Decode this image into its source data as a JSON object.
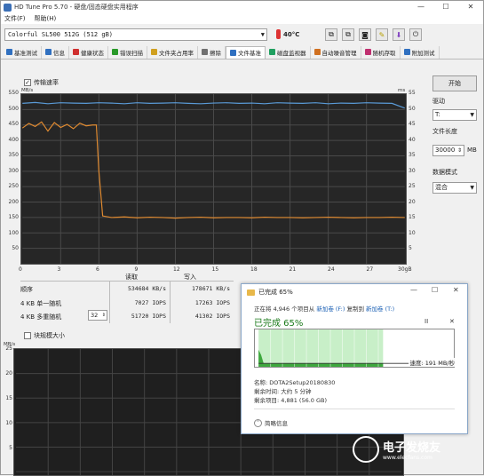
{
  "window": {
    "title": "HD Tune Pro 5.70 - 硬盘/固态硬盘实用程序"
  },
  "menu": [
    "文件(F)",
    "帮助(H)"
  ],
  "drive": {
    "selected": "Colorful SL500 512G (512 gB)",
    "temperature": "40°C"
  },
  "tabs": [
    {
      "label": "基准测试",
      "icon": "benchmark-icon",
      "color": "#3070c0"
    },
    {
      "label": "信息",
      "icon": "info-icon",
      "color": "#3070c0"
    },
    {
      "label": "健康状态",
      "icon": "health-icon",
      "color": "#d03030"
    },
    {
      "label": "错误扫描",
      "icon": "scan-icon",
      "color": "#2a9a2a"
    },
    {
      "label": "文件夹占用率",
      "icon": "folder-usage-icon",
      "color": "#d0a020"
    },
    {
      "label": "擦除",
      "icon": "erase-icon",
      "color": "#707070"
    },
    {
      "label": "文件基准",
      "icon": "file-benchmark-icon",
      "color": "#3070c0"
    },
    {
      "label": "磁盘监视器",
      "icon": "monitor-icon",
      "color": "#20a060"
    },
    {
      "label": "自动噪音管理",
      "icon": "noise-icon",
      "color": "#d07020"
    },
    {
      "label": "随机存取",
      "icon": "random-access-icon",
      "color": "#c03070"
    },
    {
      "label": "附加测试",
      "icon": "extra-tests-icon",
      "color": "#3070c0"
    }
  ],
  "transfer": {
    "checkbox_label": "传输速率",
    "checked": true,
    "unit_left": "MB/s",
    "unit_right": "ms",
    "y_left": [
      "550",
      "500",
      "450",
      "400",
      "350",
      "300",
      "250",
      "200",
      "150",
      "100",
      "50"
    ],
    "y_right": [
      "55",
      "50",
      "45",
      "40",
      "35",
      "30",
      "25",
      "20",
      "15",
      "10",
      "5"
    ],
    "x_ticks": [
      "0",
      "3",
      "6",
      "9",
      "12",
      "15",
      "18",
      "21",
      "24",
      "27",
      "30gB"
    ]
  },
  "chart_data": {
    "type": "line",
    "title": "",
    "xlabel": "",
    "ylabel": "MB/s",
    "xlim": [
      0,
      30
    ],
    "ylim": [
      0,
      550
    ],
    "grid": true,
    "series": [
      {
        "name": "",
        "color": "#5a9ad6",
        "x": [
          0,
          1,
          2,
          3,
          4,
          5,
          6,
          7,
          8,
          9,
          10,
          11,
          12,
          13,
          14,
          15,
          16,
          17,
          18,
          19,
          20,
          21,
          22,
          23,
          24,
          25,
          26,
          27,
          28,
          29,
          30
        ],
        "y": [
          520,
          523,
          519,
          522,
          521,
          520,
          522,
          521,
          519,
          522,
          520,
          521,
          522,
          520,
          519,
          521,
          522,
          520,
          521,
          519,
          522,
          521,
          520,
          522,
          519,
          521,
          520,
          522,
          521,
          520,
          505
        ]
      },
      {
        "name": "",
        "color": "#e08a30",
        "x": [
          0,
          0.5,
          1,
          1.5,
          2,
          2.5,
          3,
          3.5,
          4,
          4.5,
          5,
          5.5,
          5.8,
          6,
          6.3,
          7,
          8,
          9,
          10,
          11,
          12,
          13,
          14,
          15,
          16,
          17,
          18,
          19,
          20,
          21,
          22,
          23,
          24,
          25,
          26,
          27,
          28,
          29,
          30
        ],
        "y": [
          440,
          455,
          445,
          460,
          430,
          458,
          442,
          452,
          438,
          456,
          447,
          450,
          450,
          300,
          155,
          150,
          152,
          149,
          151,
          150,
          148,
          150,
          151,
          149,
          150,
          150,
          149,
          151,
          150,
          150,
          149,
          150,
          151,
          150,
          149,
          150,
          150,
          151,
          150
        ]
      }
    ]
  },
  "results": {
    "headers": [
      "读取",
      "写入"
    ],
    "rows": [
      {
        "label": "顺序",
        "read": "534684 KB/s",
        "write": "178671 KB/s"
      },
      {
        "label": "4 KB 单一随机",
        "read": "7027 IOPS",
        "write": "17263 IOPS"
      },
      {
        "label": "4 KB 多重随机",
        "queue": "32",
        "read": "51720 IOPS",
        "write": "41302 IOPS"
      }
    ]
  },
  "block": {
    "checkbox_label": "块规模大小",
    "unit": "MB/s",
    "y_max": "25",
    "y_ticks": [
      "25",
      "20",
      "15",
      "10",
      "5"
    ]
  },
  "right_panel": {
    "start_button": "开始",
    "drive_label": "驱动",
    "drive_value": "T:",
    "file_length_label": "文件长度",
    "file_length_value": "30000",
    "file_length_unit": "MB",
    "data_mode_label": "数据模式",
    "data_mode_value": "混合"
  },
  "copy_dialog": {
    "title": "已完成 65%",
    "status_line_prefix": "正在将 4,946 个项目从",
    "source": "新加卷 (F:)",
    "middle": "复制到",
    "dest": "新加卷 (T:)",
    "progress_title": "已完成 65%",
    "progress": 0.65,
    "speed": "速度: 191 MB/秒",
    "name_line": "名称: DOTA2Setup20180830",
    "remaining_time": "剩余时间: 大约 5 分钟",
    "remaining_items": "剩余项目: 4,881 (56.0 GB)",
    "details": "简略信息",
    "pause": "II",
    "stop": "✕"
  },
  "watermark": {
    "text": "电子发烧友",
    "sub": "www.elecfans.com"
  }
}
